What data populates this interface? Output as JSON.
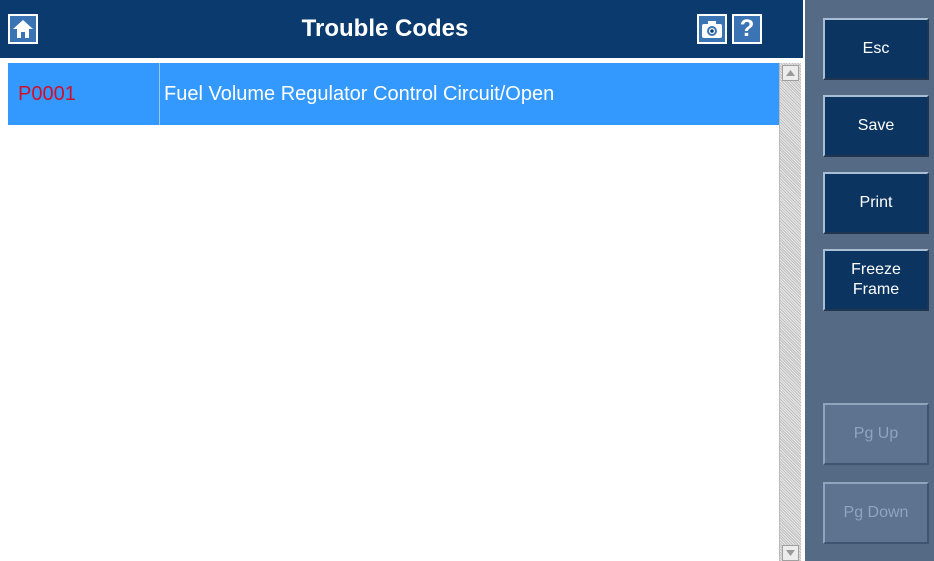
{
  "header": {
    "title": "Trouble Codes",
    "help_label": "?"
  },
  "icons": {
    "home": "home-icon",
    "camera": "camera-icon"
  },
  "trouble_codes": [
    {
      "code": "P0001",
      "description": "Fuel Volume Regulator Control Circuit/Open"
    }
  ],
  "side_buttons": {
    "esc": "Esc",
    "save": "Save",
    "print": "Print",
    "freeze_frame": "Freeze\nFrame",
    "pg_up": "Pg Up",
    "pg_down": "Pg Down"
  },
  "colors": {
    "title_bar": "#0a3a6e",
    "selected_row": "#3399ff",
    "code_text": "#d0102a",
    "side_panel": "#556b85",
    "button": "#0b3560"
  }
}
